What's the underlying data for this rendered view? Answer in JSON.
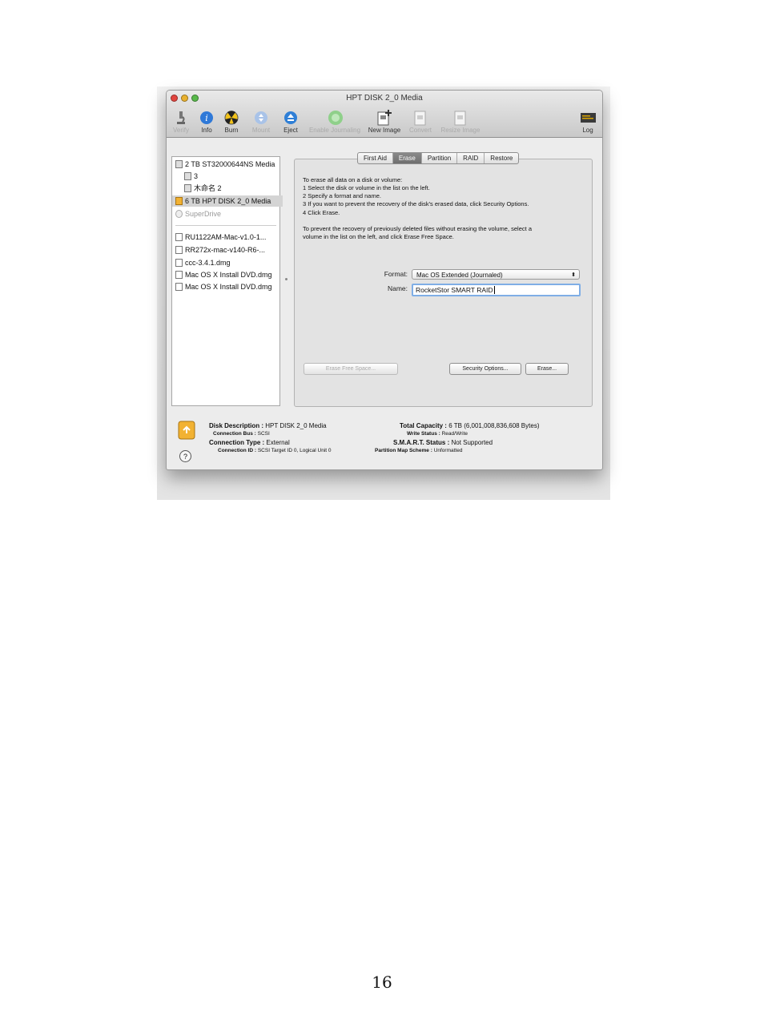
{
  "window": {
    "title": "HPT DISK 2_0 Media",
    "colors": {
      "close": "#e2453f",
      "minimize": "#e9b12e",
      "zoom": "#58b94a",
      "selected_tab": "#767676",
      "focus_ring": "#7faee6"
    }
  },
  "toolbar": {
    "items": [
      {
        "label": "Verify",
        "icon": "microscope-icon",
        "enabled": false
      },
      {
        "label": "Info",
        "icon": "info-icon",
        "enabled": true
      },
      {
        "label": "Burn",
        "icon": "burn-icon",
        "enabled": true
      },
      {
        "label": "Mount",
        "icon": "mount-icon",
        "enabled": false
      },
      {
        "label": "Eject",
        "icon": "eject-icon",
        "enabled": true
      },
      {
        "label": "Enable Journaling",
        "icon": "journaling-icon",
        "enabled": false
      },
      {
        "label": "New Image",
        "icon": "new-image-icon",
        "enabled": true
      },
      {
        "label": "Convert",
        "icon": "convert-icon",
        "enabled": false
      },
      {
        "label": "Resize Image",
        "icon": "resize-image-icon",
        "enabled": false
      },
      {
        "label": "Log",
        "icon": "log-icon",
        "enabled": true
      }
    ]
  },
  "sidebar": {
    "items": [
      {
        "label": "2 TB ST32000644NS Media",
        "indent": 0
      },
      {
        "label": "3",
        "indent": 1
      },
      {
        "label": "木命名 2",
        "indent": 1
      },
      {
        "label": "6 TB HPT DISK 2_0 Media",
        "indent": 0,
        "selected": true
      },
      {
        "label": "SuperDrive",
        "indent": 0,
        "dim": true
      },
      {
        "label": "RU1122AM-Mac-v1.0-1...",
        "indent": 0
      },
      {
        "label": "RR272x-mac-v140-R6-...",
        "indent": 0
      },
      {
        "label": "ccc-3.4.1.dmg",
        "indent": 0
      },
      {
        "label": "Mac OS X Install DVD.dmg",
        "indent": 0
      },
      {
        "label": "Mac OS X Install DVD.dmg",
        "indent": 0
      }
    ]
  },
  "tabs": [
    {
      "label": "First Aid"
    },
    {
      "label": "Erase",
      "selected": true
    },
    {
      "label": "Partition"
    },
    {
      "label": "RAID"
    },
    {
      "label": "Restore"
    }
  ],
  "erase": {
    "instructions": [
      "To erase all data on a disk or volume:",
      "1 Select the disk or volume in the list on the left.",
      "2 Specify a format and name.",
      "3 If you want to prevent the recovery of the disk's erased data, click Security Options.",
      "4 Click Erase."
    ],
    "free_space_note_1": "To prevent the recovery of previously deleted files without erasing the volume, select a",
    "free_space_note_2": "volume in the list on the left, and click Erase Free Space.",
    "format_label": "Format:",
    "format_value": "Mac OS Extended (Journaled)",
    "name_label": "Name:",
    "name_value": "RocketStor SMART RAID",
    "erase_free_space_label": "Erase Free Space...",
    "security_options_label": "Security Options...",
    "erase_label": "Erase..."
  },
  "info": {
    "disk_description_label": "Disk Description :",
    "disk_description": "HPT DISK 2_0 Media",
    "connection_bus_label": "Connection Bus :",
    "connection_bus": "SCSI",
    "connection_type_label": "Connection Type :",
    "connection_type": "External",
    "connection_id_label": "Connection ID :",
    "connection_id": "SCSI Target ID 0, Logical Unit 0",
    "total_capacity_label": "Total Capacity :",
    "total_capacity": "6 TB (6,001,008,836,608 Bytes)",
    "write_status_label": "Write Status :",
    "write_status": "Read/Write",
    "smart_status_label": "S.M.A.R.T. Status :",
    "smart_status": "Not Supported",
    "partition_map_label": "Partition Map Scheme :",
    "partition_map": "Unformatted"
  },
  "help_label": "?",
  "page_number": "16"
}
